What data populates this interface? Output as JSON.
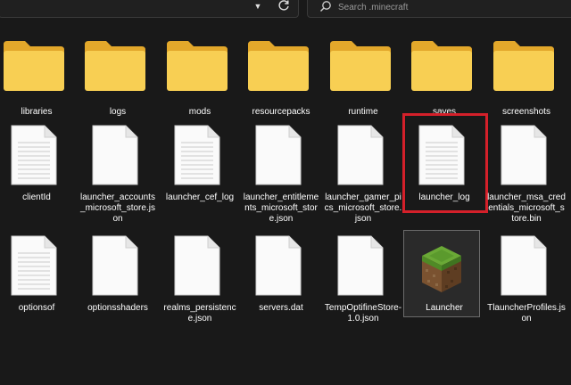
{
  "search": {
    "placeholder": "Search .minecraft"
  },
  "folders": [
    {
      "label": "libraries"
    },
    {
      "label": "logs"
    },
    {
      "label": "mods"
    },
    {
      "label": "resourcepacks"
    },
    {
      "label": "runtime"
    },
    {
      "label": "saves"
    },
    {
      "label": "screenshots"
    }
  ],
  "files_row2": [
    {
      "label": "clientId"
    },
    {
      "label": "launcher_accounts_microsoft_store.json"
    },
    {
      "label": "launcher_cef_log"
    },
    {
      "label": "launcher_entitlements_microsoft_store.json"
    },
    {
      "label": "launcher_gamer_pics_microsoft_store.json"
    },
    {
      "label": "launcher_log"
    },
    {
      "label": "launcher_msa_credentials_microsoft_store.bin"
    }
  ],
  "files_row3": [
    {
      "label": "optionsof"
    },
    {
      "label": "optionsshaders"
    },
    {
      "label": "realms_persistence.json"
    },
    {
      "label": "servers.dat"
    },
    {
      "label": "TempOptifineStore-1.0.json"
    },
    {
      "label": "Launcher"
    },
    {
      "label": "TlauncherProfiles.json"
    }
  ],
  "icons": {
    "folder": "folder-icon",
    "file": "document-icon",
    "app": "minecraft-grass-block-icon",
    "search": "search-icon",
    "refresh": "refresh-icon",
    "dropdown": "chevron-down-icon"
  },
  "colors": {
    "background": "#191919",
    "folder_front": "#f8cf53",
    "folder_back": "#e3a82b",
    "highlight": "#d4202a"
  }
}
